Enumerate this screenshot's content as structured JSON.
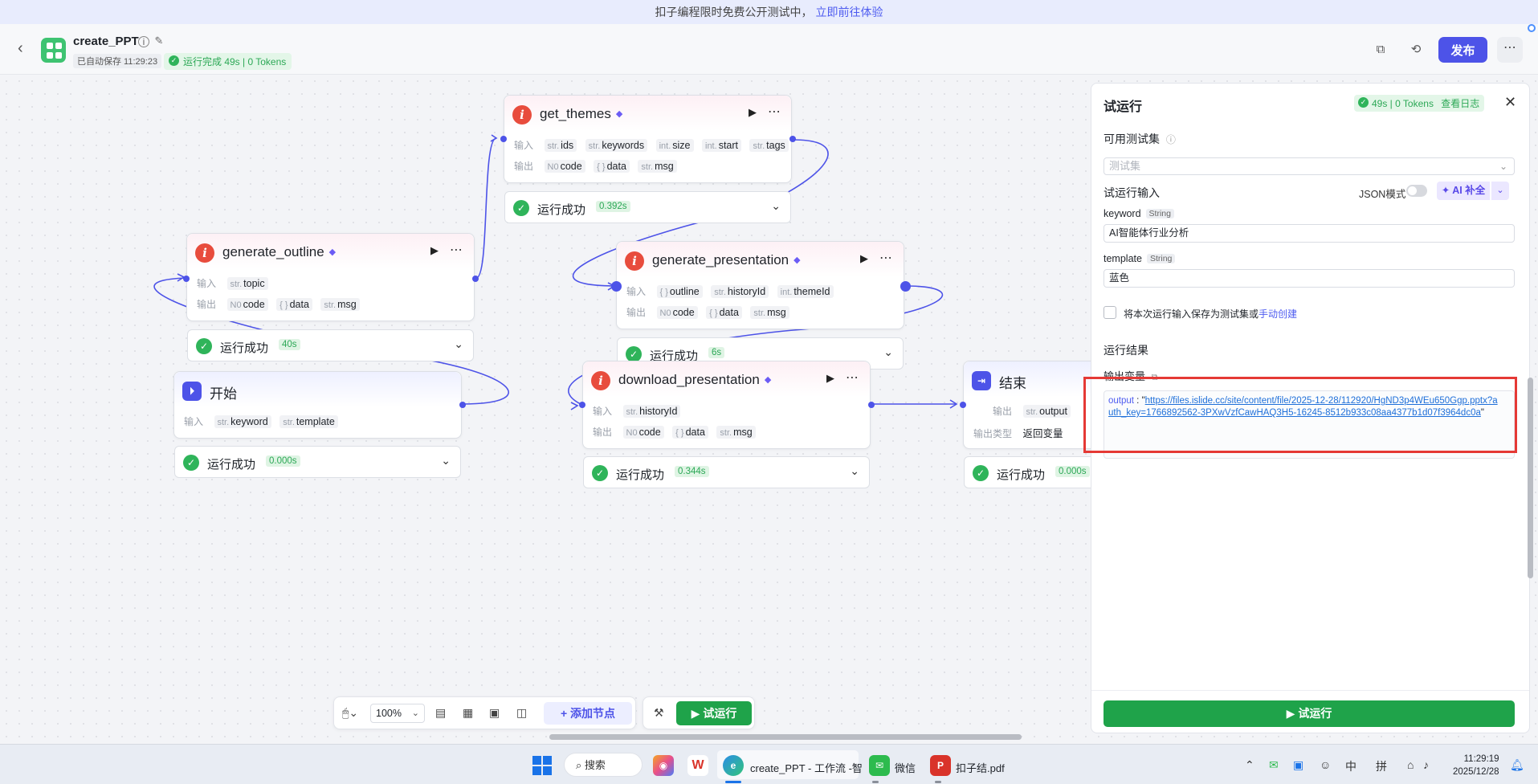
{
  "banner": {
    "text": "扣子编程限时免费公开测试中，",
    "link": "立即前往体验"
  },
  "header": {
    "title": "create_PPT",
    "saved": "已自动保存 11:29:23",
    "run_status": "运行完成 49s | 0 Tokens",
    "publish_label": "发布",
    "more_label": "⋯"
  },
  "nodes": {
    "get_themes": {
      "title": "get_themes",
      "input_label": "输入",
      "output_label": "输出",
      "inputs": [
        {
          "type": "str.",
          "name": "ids"
        },
        {
          "type": "str.",
          "name": "keywords"
        },
        {
          "type": "int.",
          "name": "size"
        },
        {
          "type": "int.",
          "name": "start"
        },
        {
          "type": "str.",
          "name": "tags"
        }
      ],
      "outputs": [
        {
          "type": "N0",
          "name": "code"
        },
        {
          "type": "{ }",
          "name": "data"
        },
        {
          "type": "str.",
          "name": "msg"
        }
      ],
      "status": "运行成功",
      "time": "0.392s"
    },
    "generate_outline": {
      "title": "generate_outline",
      "input_label": "输入",
      "output_label": "输出",
      "inputs": [
        {
          "type": "str.",
          "name": "topic"
        }
      ],
      "outputs": [
        {
          "type": "N0",
          "name": "code"
        },
        {
          "type": "{ }",
          "name": "data"
        },
        {
          "type": "str.",
          "name": "msg"
        }
      ],
      "status": "运行成功",
      "time": "40s"
    },
    "generate_presentation": {
      "title": "generate_presentation",
      "input_label": "输入",
      "output_label": "输出",
      "inputs": [
        {
          "type": "{ }",
          "name": "outline"
        },
        {
          "type": "str.",
          "name": "historyId"
        },
        {
          "type": "int.",
          "name": "themeId"
        }
      ],
      "outputs": [
        {
          "type": "N0",
          "name": "code"
        },
        {
          "type": "{ }",
          "name": "data"
        },
        {
          "type": "str.",
          "name": "msg"
        }
      ],
      "status": "运行成功",
      "time": "6s"
    },
    "start": {
      "title": "开始",
      "input_label": "输入",
      "inputs": [
        {
          "type": "str.",
          "name": "keyword"
        },
        {
          "type": "str.",
          "name": "template"
        }
      ],
      "status": "运行成功",
      "time": "0.000s"
    },
    "download_presentation": {
      "title": "download_presentation",
      "input_label": "输入",
      "output_label": "输出",
      "inputs": [
        {
          "type": "str.",
          "name": "historyId"
        }
      ],
      "outputs": [
        {
          "type": "N0",
          "name": "code"
        },
        {
          "type": "{ }",
          "name": "data"
        },
        {
          "type": "str.",
          "name": "msg"
        }
      ],
      "status": "运行成功",
      "time": "0.344s"
    },
    "end": {
      "title": "结束",
      "output_label": "输出",
      "output_type_label": "输出类型",
      "output": {
        "type": "str.",
        "name": "output"
      },
      "output_type": "返回变量",
      "status": "运行成功",
      "time": "0.000s"
    }
  },
  "panel": {
    "title": "试运行",
    "badge": "49s | 0 Tokens",
    "view_log": "查看日志",
    "test_set_label": "可用测试集",
    "test_set_placeholder": "测试集",
    "run_input_label": "试运行输入",
    "json_mode": "JSON模式",
    "ai_fill": "AI 补全",
    "fields": [
      {
        "name": "keyword",
        "type": "String",
        "value": "AI智能体行业分析"
      },
      {
        "name": "template",
        "type": "String",
        "value": "蓝色"
      }
    ],
    "save_checkbox_text": "将本次运行输入保存为测试集或",
    "save_checkbox_link": "手动创建",
    "result_label": "运行结果",
    "output_var_label": "输出变量",
    "output_key": "output",
    "output_url": "https://files.islide.cc/site/content/file/2025-12-28/112920/HgND3p4WEu650Ggp.pptx?auth_key=1766892562-3PXwVzfCawHAQ3H5-16245-8512b933c08aa4377b1d07f3964dc0a",
    "run_button": "试运行"
  },
  "toolbar": {
    "zoom": "100%",
    "add_node": "添加节点",
    "trial_run": "试运行"
  },
  "taskbar": {
    "search": "搜索",
    "edge_window": "create_PPT - 工作流 -智",
    "wechat": "微信",
    "pdf": "扣子结.pdf",
    "ime1": "中",
    "ime2": "拼",
    "time": "11:29:19",
    "date": "2025/12/28"
  },
  "colors": {
    "accent": "#4d53e8",
    "success": "#1fa34a",
    "plugin_icon": "#e84c3d",
    "highlight_frame": "#e53935"
  }
}
